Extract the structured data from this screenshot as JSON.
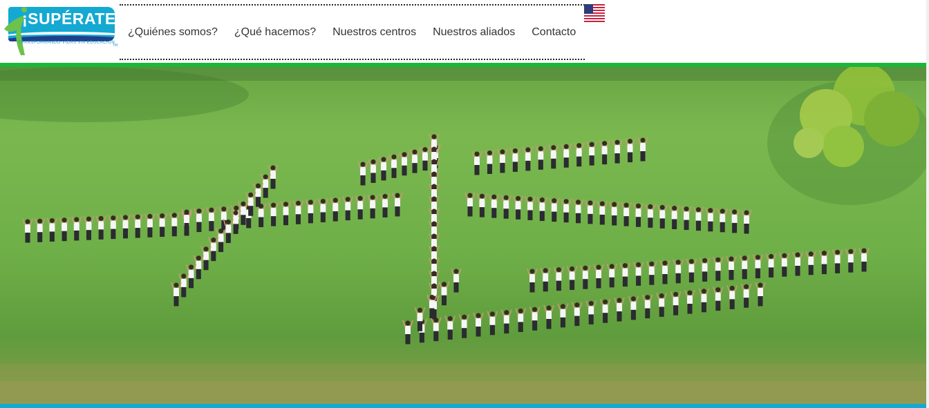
{
  "brand": {
    "logo_title": "¡SUPÉRATE!",
    "logo_tagline": "TRANSFORMANDO VIDAS VÍA EDUCACIÓN",
    "logo_tm": "TM"
  },
  "nav": {
    "items": [
      {
        "label": "¿Quiénes somos?"
      },
      {
        "label": "¿Qué hacemos?"
      },
      {
        "label": "Nuestros centros"
      },
      {
        "label": "Nuestros aliados"
      },
      {
        "label": "Contacto"
      }
    ],
    "language_flag": "us-flag-icon"
  },
  "colors": {
    "accent_green": "#19b839",
    "brand_blue": "#14a9d2",
    "brand_navy": "#1e3f8c",
    "grass": "#6faf48"
  },
  "hero": {
    "image_subject": "aerial-photo-students-forming-number"
  }
}
